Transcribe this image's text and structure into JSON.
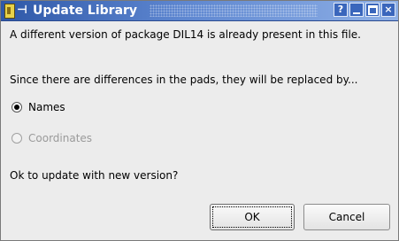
{
  "window": {
    "title": "Update Library",
    "controls": {
      "help": "?",
      "close": "×"
    }
  },
  "message": {
    "line1": "A different version of package DIL14 is already present in this file.",
    "line2": "Since there are differences in the pads, they will be replaced by..."
  },
  "options": [
    {
      "label": "Names",
      "checked": true,
      "enabled": true
    },
    {
      "label": "Coordinates",
      "checked": false,
      "enabled": false
    }
  ],
  "question": "Ok to update with new version?",
  "buttons": {
    "ok": "OK",
    "cancel": "Cancel"
  },
  "colors": {
    "titlebar_start": "#2f58a8",
    "titlebar_end": "#8fb0e6"
  }
}
